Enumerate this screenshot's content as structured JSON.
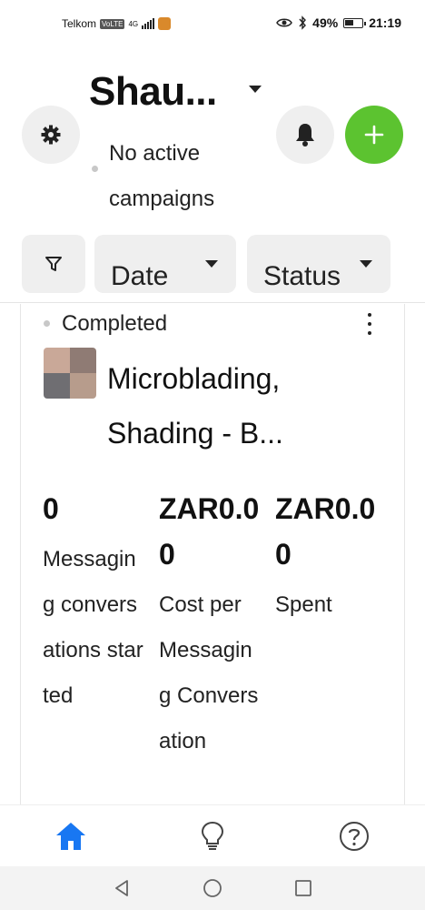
{
  "status_bar": {
    "carrier": "Telkom",
    "network_badge": "VoLTE",
    "network_type": "4G",
    "battery": "49%",
    "time": "21:19"
  },
  "header": {
    "account_name": "Shau...",
    "campaign_status": "No active campaigns"
  },
  "filters": {
    "date_label": "Date",
    "status_label": "Status"
  },
  "campaign": {
    "status": "Completed",
    "name": "Microblading, Shading - B...",
    "metrics": [
      {
        "value": "0",
        "label": "Messaging conversations started"
      },
      {
        "value": "ZAR0.00",
        "label": "Cost per Messaging Conversation"
      },
      {
        "value": "ZAR0.00",
        "label": "Spent"
      }
    ]
  },
  "colors": {
    "accent_green": "#5cc330",
    "nav_active_blue": "#1877f2",
    "button_gray": "#efefef"
  },
  "icons": {
    "settings": "gear-icon",
    "notifications": "bell-icon",
    "create": "plus-icon",
    "filter": "funnel-icon",
    "home": "home-icon",
    "ideas": "lightbulb-icon",
    "help": "help-icon"
  }
}
